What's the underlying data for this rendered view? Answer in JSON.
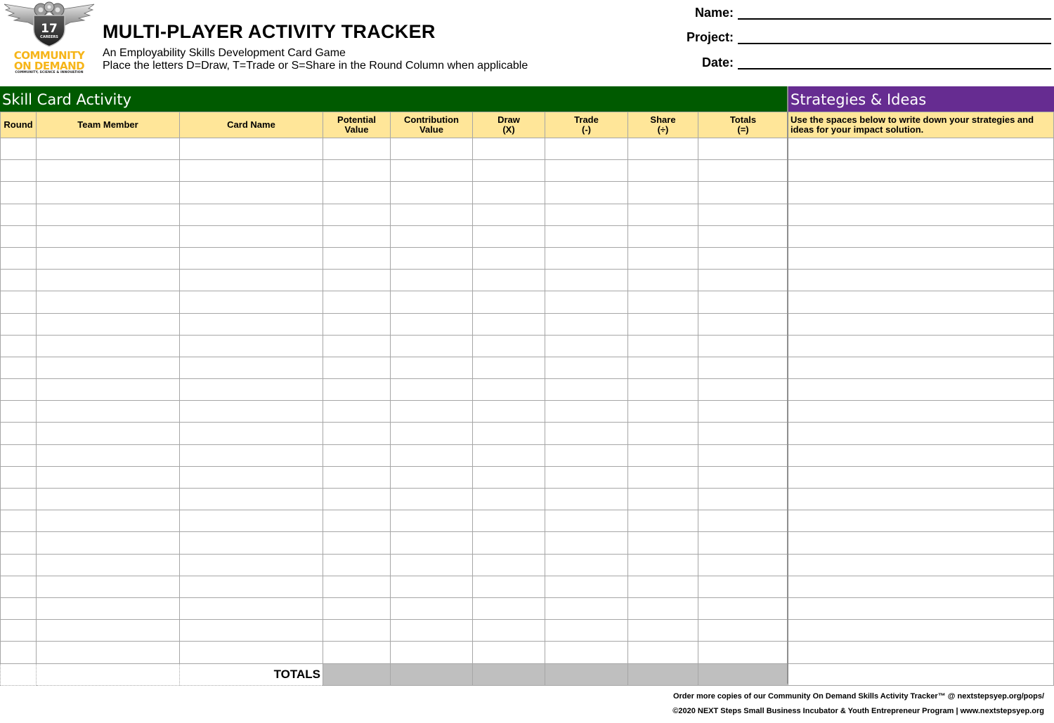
{
  "logo": {
    "badge_number": "17",
    "badge_word": "CAREERS",
    "word1": "COMMUNITY",
    "word2": "ON DEMAND",
    "tagline": "COMMUNITY, SCIENCE & INNOVATION"
  },
  "header": {
    "title": "MULTI-PLAYER ACTIVITY TRACKER",
    "subtitle": "An Employability Skills Development Card Game",
    "instructions": "Place the letters D=Draw, T=Trade or S=Share in the Round Column when applicable"
  },
  "fields": {
    "name_label": "Name:",
    "project_label": "Project:",
    "date_label": "Date:"
  },
  "skill_section": {
    "title": "Skill Card Activity",
    "columns": [
      {
        "line1": "Round",
        "line2": ""
      },
      {
        "line1": "Team Member",
        "line2": ""
      },
      {
        "line1": "Card Name",
        "line2": ""
      },
      {
        "line1": "Potential",
        "line2": "Value"
      },
      {
        "line1": "Contribution",
        "line2": "Value"
      },
      {
        "line1": "Draw",
        "line2": "(X)"
      },
      {
        "line1": "Trade",
        "line2": "(-)"
      },
      {
        "line1": "Share",
        "line2": "(÷)"
      },
      {
        "line1": "Totals",
        "line2": "(=)"
      }
    ],
    "totals_label": "TOTALS"
  },
  "strategies_section": {
    "title": "Strategies & Ideas",
    "instructions": "Use the spaces below to write down your strategies and ideas for your impact solution."
  },
  "footer": {
    "order_line": "Order more copies of our Community On Demand Skills Activity Tracker™ @ nextstepsyep.org/pops/",
    "copyright_line": "©2020 NEXT Steps Small Business Incubator & Youth Entrepreneur Program | www.nextstepsyep.org"
  },
  "colors": {
    "skill_header_bg": "#005a00",
    "strategies_header_bg": "#662c91",
    "column_header_bg": "#ffe699",
    "totals_cell_bg": "#bfbfbf",
    "logo_gold": "#f6b519"
  }
}
